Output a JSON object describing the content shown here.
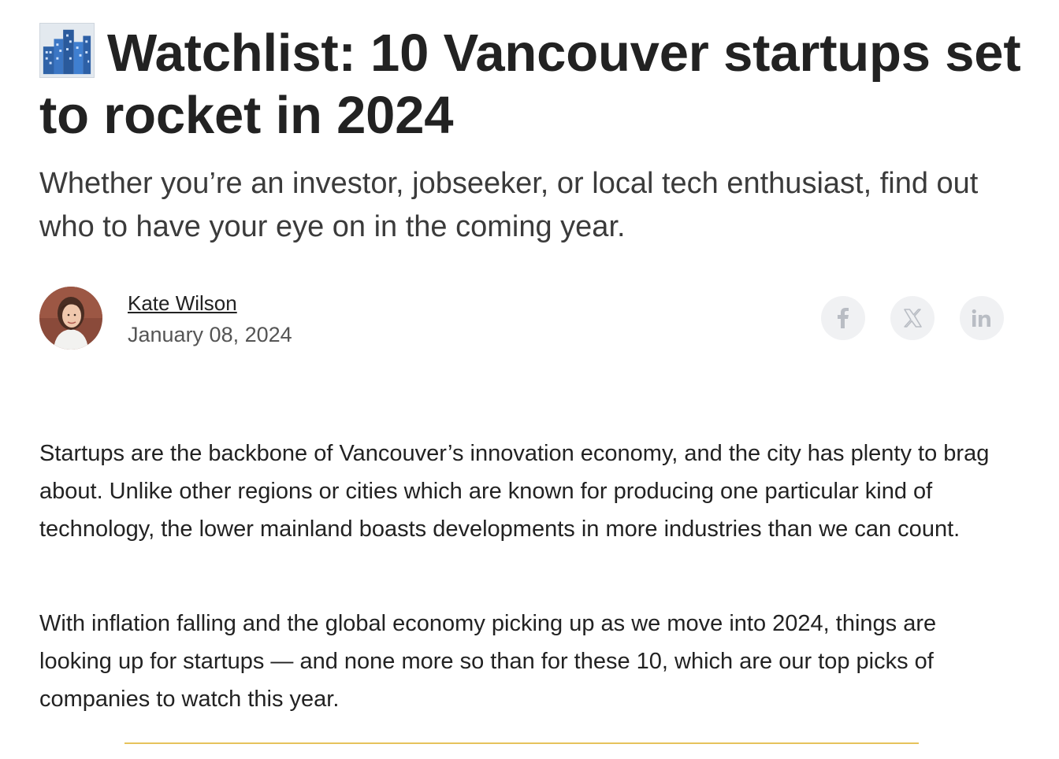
{
  "article": {
    "title_icon": "cityscape-icon",
    "title": "Watchlist: 10 Vancouver startups set to rocket in 2024",
    "subtitle": "Whether you’re an investor, jobseeker, or local tech enthusiast, find out who to have your eye on in the coming year.",
    "author": {
      "name": "Kate Wilson",
      "date": "January 08, 2024",
      "avatar": "author-avatar"
    },
    "share": [
      {
        "icon": "facebook-icon"
      },
      {
        "icon": "x-icon"
      },
      {
        "icon": "linkedin-icon"
      }
    ],
    "paragraphs": [
      "Startups are the backbone of Vancouver’s innovation economy, and the city has plenty to brag about. Unlike other regions or cities which are known for producing one particular kind of technology, the lower mainland boasts developments in more industries than we can count.",
      "With inflation falling and the global economy picking up as we move into 2024, things are looking up for startups — and none more so than for these 10, which are our top picks of companies to watch this year."
    ]
  },
  "colors": {
    "text": "#222222",
    "subtitle": "#3b3b3b",
    "muted": "#555555",
    "share_bg": "#f0f1f3",
    "share_icon": "#b9bdc4",
    "divider": "#e6c35c"
  }
}
